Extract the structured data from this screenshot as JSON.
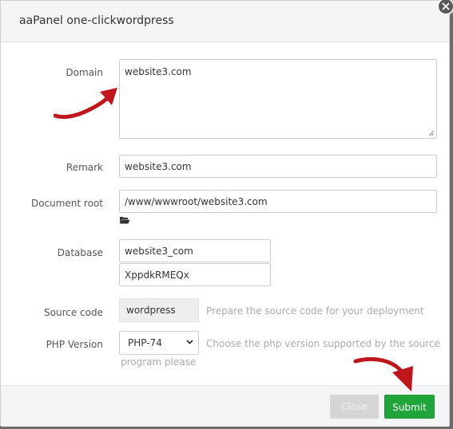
{
  "dialog": {
    "title": "aaPanel one-clickwordpress"
  },
  "form": {
    "domain": {
      "label": "Domain",
      "value": "website3.com"
    },
    "remark": {
      "label": "Remark",
      "value": "website3.com"
    },
    "document_root": {
      "label": "Document root",
      "value": "/www/wwwroot/website3.com"
    },
    "database": {
      "label": "Database",
      "name_value": "website3_com",
      "password_value": "XppdkRMEQx"
    },
    "source_code": {
      "label": "Source code",
      "value": "wordpress",
      "hint": "Prepare the source code for your deployment"
    },
    "php_version": {
      "label": "PHP Version",
      "selected": "PHP-74",
      "hint_line1": "Choose the php version supported by the source",
      "hint_line2": "program please"
    }
  },
  "buttons": {
    "close_label": "Close",
    "submit_label": "Submit"
  },
  "icons": {
    "close": "close-icon",
    "folder": "folder-open-icon",
    "select_chevron": "chevron-down-icon",
    "arrow": "red-arrow-annotation"
  },
  "colors": {
    "accent_green": "#20a53a",
    "annotation_red": "#c0161b"
  }
}
